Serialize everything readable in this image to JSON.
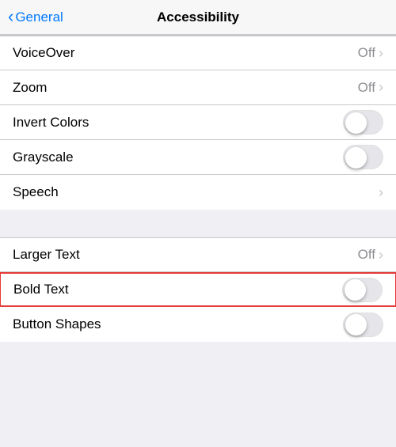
{
  "nav": {
    "back_label": "General",
    "title": "Accessibility"
  },
  "section1": {
    "rows": [
      {
        "label": "VoiceOver",
        "right_text": "Off",
        "has_chevron": true,
        "toggle": false,
        "show_toggle": false
      },
      {
        "label": "Zoom",
        "right_text": "Off",
        "has_chevron": true,
        "toggle": false,
        "show_toggle": false
      },
      {
        "label": "Invert Colors",
        "right_text": "",
        "has_chevron": false,
        "toggle": true,
        "show_toggle": true,
        "toggle_on": false
      },
      {
        "label": "Grayscale",
        "right_text": "",
        "has_chevron": false,
        "toggle": true,
        "show_toggle": true,
        "toggle_on": false
      },
      {
        "label": "Speech",
        "right_text": "",
        "has_chevron": true,
        "toggle": false,
        "show_toggle": false
      }
    ]
  },
  "section2": {
    "rows": [
      {
        "label": "Larger Text",
        "right_text": "Off",
        "has_chevron": true,
        "toggle": false,
        "show_toggle": false,
        "bold": false
      },
      {
        "label": "Bold Text",
        "right_text": "",
        "has_chevron": false,
        "toggle": true,
        "show_toggle": true,
        "toggle_on": false,
        "bold": true
      },
      {
        "label": "Button Shapes",
        "right_text": "",
        "has_chevron": false,
        "toggle": true,
        "show_toggle": true,
        "toggle_on": false,
        "bold": false
      }
    ]
  },
  "colors": {
    "accent": "#007aff",
    "highlight": "#e53935"
  }
}
